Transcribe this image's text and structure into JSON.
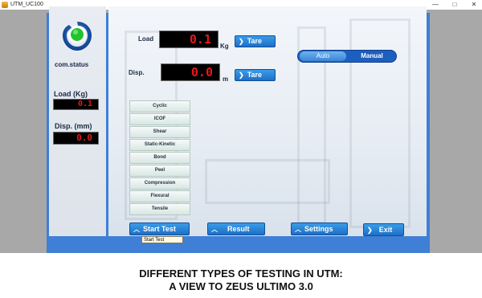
{
  "window": {
    "title": "UTM_UC100",
    "controls": [
      "—",
      "□",
      "✕"
    ]
  },
  "status": {
    "label": "com.status",
    "icon": "status-indicator-icon",
    "color": "#22c32e"
  },
  "readouts": {
    "load_label": "Load (Kg)",
    "load_value": "0.1",
    "disp_label": "Disp. (mm)",
    "disp_value": "0.0"
  },
  "main": {
    "load_label": "Load",
    "load_value": "0.1",
    "load_unit": "Kg",
    "disp_label": "Disp.",
    "disp_value": "0.0",
    "disp_unit": "m",
    "tare_label": "Tare"
  },
  "mode": {
    "auto": "Auto",
    "manual": "Manual",
    "selected": "Auto"
  },
  "tests": [
    "Cyclic",
    "ICOF",
    "Shear",
    "Static-Kinetic",
    "Bond",
    "Peel",
    "Compression",
    "Flexural",
    "Tensile"
  ],
  "actions": {
    "start_test": "Start Test",
    "result": "Result",
    "settings": "Settings",
    "exit": "Exit"
  },
  "tooltip": "Start Test",
  "caption": {
    "line1": "DIFFERENT TYPES OF TESTING IN UTM:",
    "line2": "A VIEW TO ZEUS ULTIMO 3.0"
  },
  "colors": {
    "frame": "#3f7fd6",
    "led_text": "#e81818",
    "button": "#1e6fc6"
  }
}
